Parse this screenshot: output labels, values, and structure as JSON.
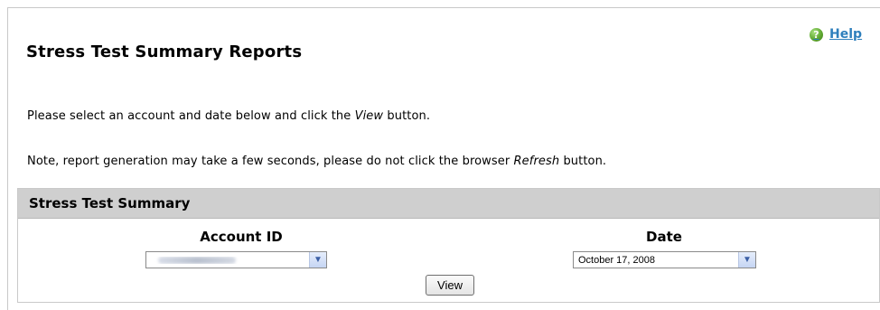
{
  "page": {
    "title": "Stress Test Summary Reports",
    "help_label": "Help",
    "help_icon": "?",
    "instructions": {
      "line1_before": "Please select an account and date below and click the ",
      "line1_emph": "View",
      "line1_after": " button.",
      "line2_before": "Note, report generation may take a few seconds, please do not click the browser ",
      "line2_emph": "Refresh",
      "line2_after": " button."
    }
  },
  "panel": {
    "header": "Stress Test Summary",
    "account_label": "Account ID",
    "account_value_blurred": true,
    "date_label": "Date",
    "date_value": "October 17, 2008",
    "dropdown_icon": "chevron-down-icon",
    "view_button": "View"
  },
  "colors": {
    "panel_header": "#cfcfcf",
    "help_link": "#2e7fbc",
    "help_icon": "#5fa832"
  }
}
